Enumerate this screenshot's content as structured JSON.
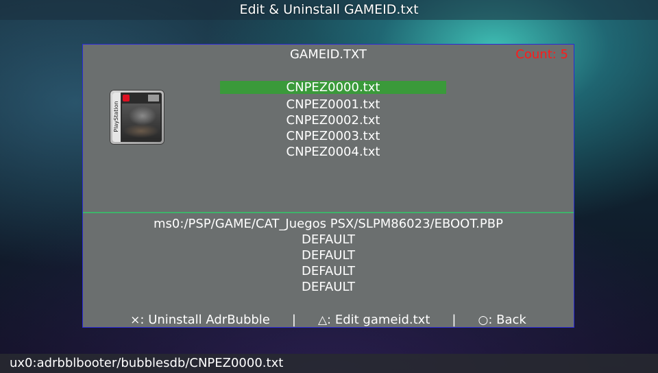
{
  "title_bar": {
    "text": "Edit & Uninstall GAMEID.txt"
  },
  "panel": {
    "header": "GAMEID.TXT",
    "count_label": "Count: 5",
    "count_color": "#ff1a1a",
    "cover_icon": "playstation-game-cover",
    "cover_spine_text": "PlayStation",
    "files": [
      {
        "name": "CNPEZ0000.txt",
        "selected": true
      },
      {
        "name": "CNPEZ0001.txt",
        "selected": false
      },
      {
        "name": "CNPEZ0002.txt",
        "selected": false
      },
      {
        "name": "CNPEZ0003.txt",
        "selected": false
      },
      {
        "name": "CNPEZ0004.txt",
        "selected": false
      }
    ],
    "selection_color": "#3a9a3a",
    "details": {
      "path": "ms0:/PSP/GAME/CAT_Juegos PSX/SLPM86023/EBOOT.PBP",
      "line2": "DEFAULT",
      "line3": "DEFAULT",
      "line4": "DEFAULT",
      "line5": "DEFAULT"
    },
    "actions": {
      "uninstall": {
        "glyph": "×",
        "label": ": Uninstall AdrBubble",
        "icon": "cross-button-icon"
      },
      "separator": "|",
      "edit": {
        "glyph": "△",
        "label": ": Edit gameid.txt",
        "icon": "triangle-button-icon"
      },
      "back": {
        "glyph": "○",
        "label": ": Back",
        "icon": "circle-button-icon"
      }
    }
  },
  "status_bar": {
    "text": "ux0:adrbblbooter/bubblesdb/CNPEZ0000.txt"
  }
}
